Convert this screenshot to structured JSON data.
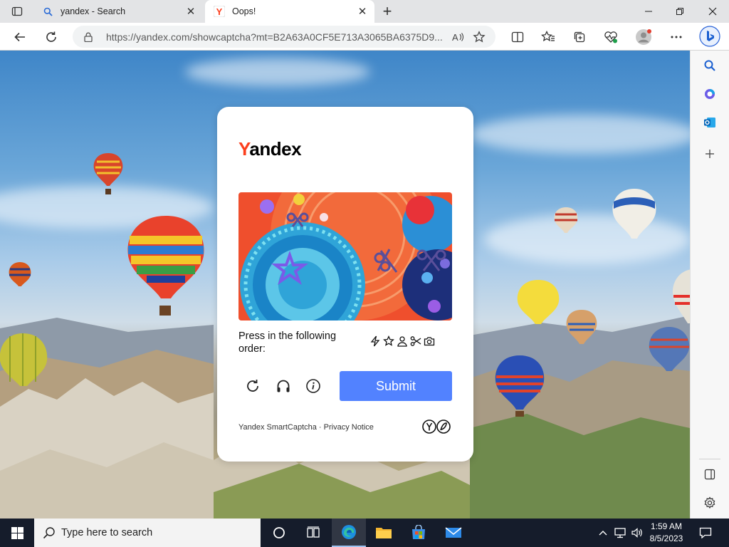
{
  "browser": {
    "tabs": [
      {
        "title": "yandex - Search",
        "active": false
      },
      {
        "title": "Oops!",
        "active": true
      }
    ],
    "url": "https://yandex.com/showcaptcha?mt=B2A63A0CF5E713A3065BA6375D9..."
  },
  "captcha": {
    "logo": {
      "first_letter": "Y",
      "rest": "andex"
    },
    "instruction": "Press in the following order:",
    "order_icons": [
      "lightning-icon",
      "star-icon",
      "person-icon",
      "scissors-icon",
      "camera-icon"
    ],
    "submit_label": "Submit",
    "footer": "Yandex SmartCaptcha · Privacy Notice"
  },
  "taskbar": {
    "search_placeholder": "Type here to search",
    "time": "1:59 AM",
    "date": "8/5/2023"
  },
  "colors": {
    "yandex_red": "#fc3f1d",
    "submit_blue": "#5282ff",
    "taskbar": "#151c2b"
  }
}
